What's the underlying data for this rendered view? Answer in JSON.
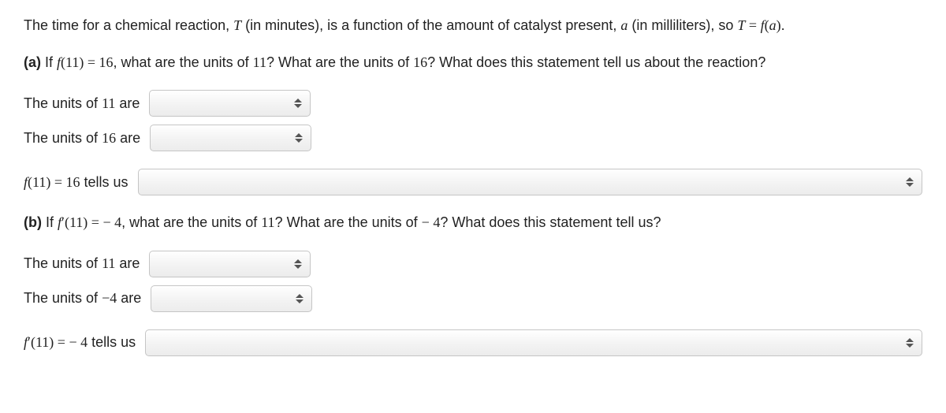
{
  "intro": {
    "t1": "The time for a chemical reaction, ",
    "T": "T",
    "t2": " (in minutes), is a function of the amount of catalyst present, ",
    "a": "a",
    "t3": " (in milliliters), so ",
    "eqT": "T",
    "eq": " = ",
    "fa_f": "f",
    "fa_open": "(",
    "fa_a": "a",
    "fa_close": ")",
    "period": "."
  },
  "partA": {
    "label": "(a)",
    "t1": " If ",
    "f": "f",
    "open": "(",
    "eleven": "11",
    "close": ")",
    "eq": " = ",
    "sixteen": "16",
    "t2": ", what are the units of ",
    "eleven2": "11",
    "t3": "? What are the units of ",
    "sixteen2": "16",
    "t4": "? What does this statement tell us about the reaction?"
  },
  "rowsA": {
    "u11_pre": "The units of ",
    "u11_num": "11",
    "u11_post": " are",
    "u16_pre": "The units of ",
    "u16_num": "16",
    "u16_post": " are",
    "tells_f": "f",
    "tells_open": "(",
    "tells_11": "11",
    "tells_close": ")",
    "tells_eq": " = ",
    "tells_16": "16",
    "tells_post": " tells us"
  },
  "partB": {
    "label": "(b)",
    "t1": " If ",
    "f": "f",
    "prime": "′",
    "open": "(",
    "eleven": "11",
    "close": ")",
    "eq": " = ",
    "neg4": " − 4",
    "t2": ", what are the units of ",
    "eleven2": "11",
    "t3": "? What are the units of ",
    "neg4b": "− 4",
    "t4": "? What does this statement tell us?"
  },
  "rowsB": {
    "u11_pre": "The units of ",
    "u11_num": "11",
    "u11_post": " are",
    "u4_pre": "The units of ",
    "u4_num": "−4",
    "u4_post": " are",
    "tells_f": "f",
    "tells_prime": "′",
    "tells_open": "(",
    "tells_11": "11",
    "tells_close": ")",
    "tells_eq": " = ",
    "tells_neg4": " − 4",
    "tells_post": " tells us"
  }
}
